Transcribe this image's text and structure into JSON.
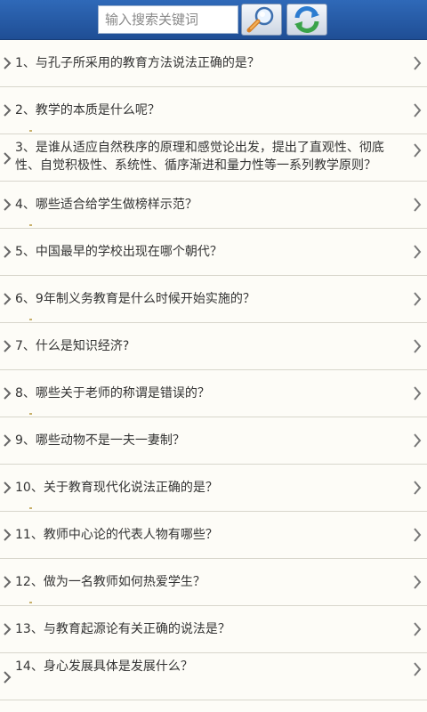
{
  "search": {
    "placeholder": "输入搜索关键词",
    "value": ""
  },
  "icons": {
    "search": "magnifier-icon",
    "refresh": "refresh-icon",
    "row_left": "chevron-right-icon",
    "row_right": "chevron-right-icon"
  },
  "colors": {
    "header": "#245aa8",
    "background": "#fdfcf7",
    "text": "#333333",
    "divider": "#d8d6cc",
    "refresh_green": "#3aa34a",
    "refresh_blue": "#2c7cd0"
  },
  "questions": [
    {
      "text": "1、与孔子所采用的教育方法说法正确的是？"
    },
    {
      "text": "2、教学的本质是什么呢？"
    },
    {
      "text": "3、是谁从适应自然秩序的原理和感觉论出发，提出了直观性、彻底性、自觉积极性、系统性、循序渐进和量力性等一系列教学原则？"
    },
    {
      "text": "4、哪些适合给学生做榜样示范？"
    },
    {
      "text": "5、中国最早的学校出现在哪个朝代？"
    },
    {
      "text": "6、9年制义务教育是什么时候开始实施的？"
    },
    {
      "text": "7、什么是知识经济?"
    },
    {
      "text": "8、哪些关于老师的称谓是错误的？"
    },
    {
      "text": "9、哪些动物不是一夫一妻制？"
    },
    {
      "text": "10、关于教育现代化说法正确的是？"
    },
    {
      "text": "11、教师中心论的代表人物有哪些？"
    },
    {
      "text": "12、做为一名教师如何热爱学生？"
    },
    {
      "text": "13、与教育起源论有关正确的说法是？"
    },
    {
      "text": "14、身心发展具体是发展什么？"
    }
  ]
}
